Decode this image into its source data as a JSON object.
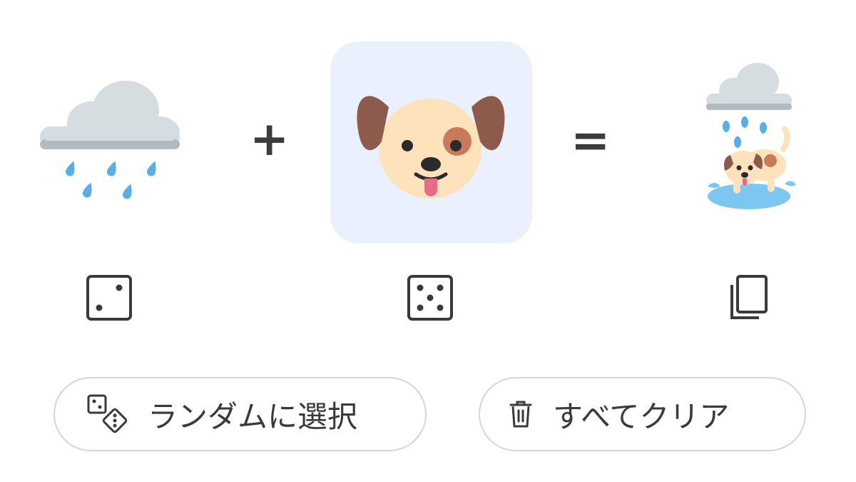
{
  "mixer": {
    "left_emoji": {
      "icon": "cloud-with-rain"
    },
    "operator_plus": "+",
    "right_emoji": {
      "icon": "dog-face",
      "selected": true
    },
    "operator_equals": "=",
    "result_emoji": {
      "icon": "dog-in-rain-puddle"
    }
  },
  "controls": {
    "left_randomize_icon": "die-two",
    "right_randomize_icon": "die-five",
    "copy_icon": "copy"
  },
  "actions": {
    "random_label": "ランダムに選択",
    "clear_label": "すべてクリア"
  },
  "colors": {
    "selected_slot_bg": "#eaf0fd",
    "text": "#3a3a3a",
    "pill_border": "#d6d6d6"
  }
}
